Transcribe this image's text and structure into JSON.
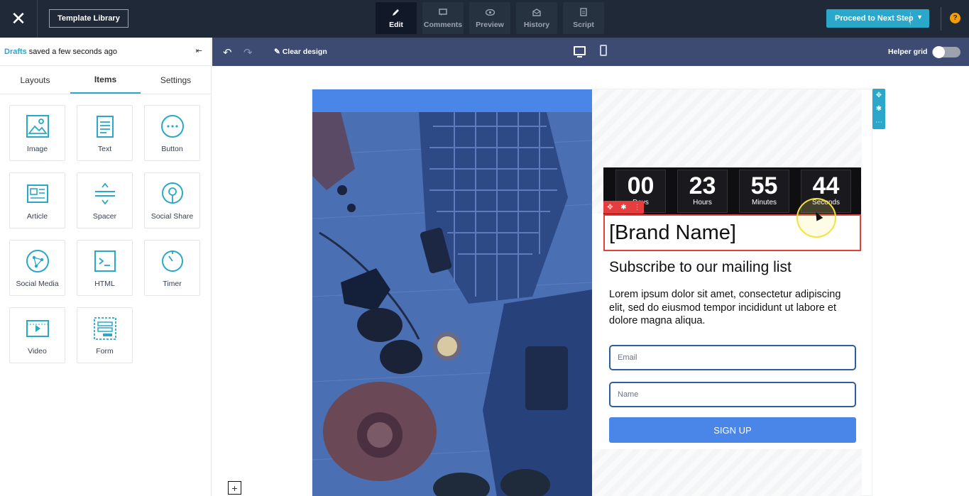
{
  "topbar": {
    "template_library": "Template Library",
    "tabs": [
      {
        "label": "Edit",
        "icon": "pencil-icon"
      },
      {
        "label": "Comments",
        "icon": "comment-icon"
      },
      {
        "label": "Preview",
        "icon": "eye-icon"
      },
      {
        "label": "History",
        "icon": "history-icon"
      },
      {
        "label": "Script",
        "icon": "script-icon"
      }
    ],
    "proceed": "Proceed to Next Step",
    "help": "?"
  },
  "panel": {
    "drafts": "Drafts",
    "saved": "saved a few seconds ago",
    "tabs": [
      "Layouts",
      "Items",
      "Settings"
    ],
    "items": [
      {
        "label": "Image",
        "icon": "image-icon"
      },
      {
        "label": "Text",
        "icon": "text-icon"
      },
      {
        "label": "Button",
        "icon": "button-icon"
      },
      {
        "label": "Article",
        "icon": "article-icon"
      },
      {
        "label": "Spacer",
        "icon": "spacer-icon"
      },
      {
        "label": "Social Share",
        "icon": "social-share-icon"
      },
      {
        "label": "Social Media",
        "icon": "social-media-icon"
      },
      {
        "label": "HTML",
        "icon": "html-icon"
      },
      {
        "label": "Timer",
        "icon": "timer-icon"
      },
      {
        "label": "Video",
        "icon": "video-icon"
      },
      {
        "label": "Form",
        "icon": "form-icon"
      }
    ]
  },
  "toolbar": {
    "clear": "Clear design",
    "helper_grid": "Helper grid"
  },
  "template": {
    "countdown": [
      {
        "value": "00",
        "label": "Days"
      },
      {
        "value": "23",
        "label": "Hours"
      },
      {
        "value": "55",
        "label": "Minutes"
      },
      {
        "value": "44",
        "label": "Seconds"
      }
    ],
    "brand": "[Brand Name]",
    "subscribe": "Subscribe to our mailing list",
    "lorem": "Lorem ipsum dolor sit amet, consectetur adipiscing elit, sed do eiusmod tempor incididunt ut labore et dolore magna aliqua.",
    "email_placeholder": "Email",
    "name_placeholder": "Name",
    "signup": "SIGN UP"
  },
  "colors": {
    "accent": "#2aa7c9",
    "topbar": "#1f2937",
    "toolbar": "#3d4b73",
    "cta": "#4a86e8",
    "selection": "#e53e3e"
  }
}
